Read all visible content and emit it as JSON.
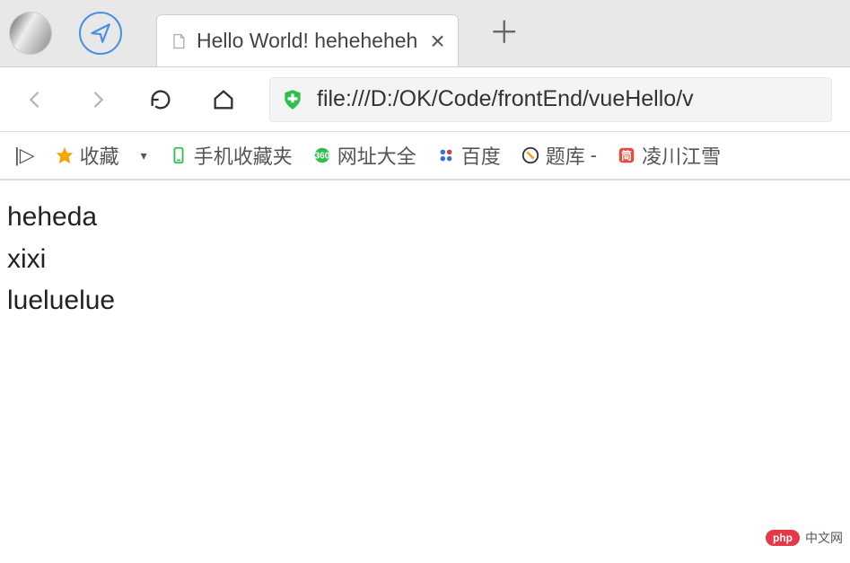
{
  "tab": {
    "title": "Hello World! heheheheh",
    "close": "×"
  },
  "addressBar": {
    "url": "file:///D:/OK/Code/frontEnd/vueHello/v"
  },
  "bookmarks": {
    "sidebar": "|▷",
    "favorites": "收藏",
    "mobile": "手机收藏夹",
    "sites": "网址大全",
    "baidu": "百度",
    "tiku": "题库",
    "lingchuan": "凌川江雪",
    "dash": "-"
  },
  "content": {
    "line1": "heheda",
    "line2": "xixi",
    "line3": "lueluelue"
  },
  "watermark": {
    "badge": "php",
    "text": "中文网"
  }
}
